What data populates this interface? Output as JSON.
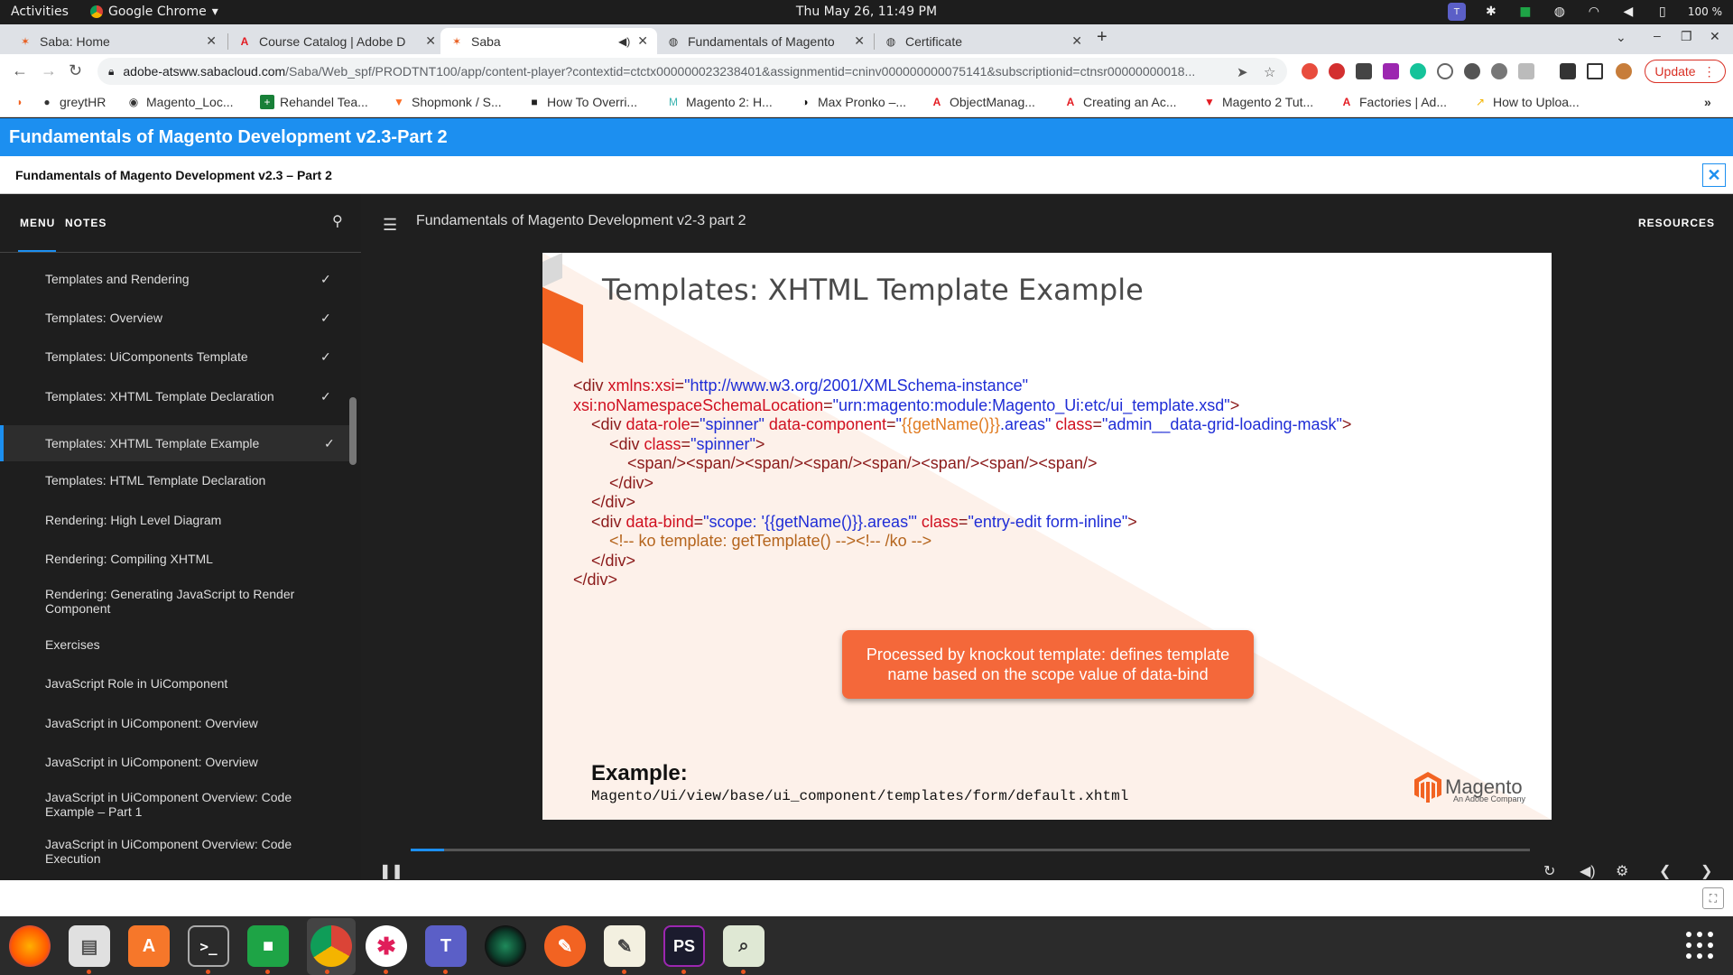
{
  "gnome": {
    "activities": "Activities",
    "app_menu": "Google Chrome",
    "clock": "Thu May 26, 11:49 PM",
    "battery": "100 %"
  },
  "tabs": [
    {
      "title": "Saba: Home",
      "active": false
    },
    {
      "title": "Course Catalog | Adobe D",
      "active": false
    },
    {
      "title": "Saba",
      "active": true
    },
    {
      "title": "Fundamentals of Magento",
      "active": false
    },
    {
      "title": "Certificate",
      "active": false
    }
  ],
  "address": {
    "host": "adobe-atsww.sabacloud.com",
    "path": "/Saba/Web_spf/PRODTNT100/app/content-player?contextid=ctctx000000023238401&assignmentid=cninv000000000075141&subscriptionid=ctnsr00000000018..."
  },
  "update_label": "Update",
  "bookmarks": [
    {
      "label": "greytHR"
    },
    {
      "label": "Magento_Loc..."
    },
    {
      "label": "Rehandel Tea..."
    },
    {
      "label": "Shopmonk / S..."
    },
    {
      "label": "How To Overri..."
    },
    {
      "label": "Magento 2: H..."
    },
    {
      "label": "Max Pronko –..."
    },
    {
      "label": "ObjectManag..."
    },
    {
      "label": "Creating an Ac..."
    },
    {
      "label": "Magento 2 Tut..."
    },
    {
      "label": "Factories | Ad..."
    },
    {
      "label": "How to Uploa..."
    }
  ],
  "app": {
    "header": "Fundamentals of Magento Development v2.3-Part 2",
    "subheader": "Fundamentals of Magento Development v2.3 – Part 2"
  },
  "sidebar": {
    "tab_menu": "MENU",
    "tab_notes": "NOTES",
    "items": [
      {
        "label": "Templates and Rendering",
        "done": true
      },
      {
        "label": "Templates: Overview",
        "done": true
      },
      {
        "label": "Templates: UiComponents Template",
        "done": true
      },
      {
        "label": "Templates: XHTML Template Declaration",
        "done": true
      },
      {
        "label": "Templates: XHTML Template Example",
        "done": true,
        "active": true
      },
      {
        "label": "Templates: HTML Template Declaration",
        "done": false
      },
      {
        "label": "Rendering: High Level Diagram",
        "done": false
      },
      {
        "label": "Rendering: Compiling XHTML",
        "done": false
      },
      {
        "label": "Rendering: Generating JavaScript to Render Component",
        "done": false
      },
      {
        "label": "Exercises",
        "done": false
      },
      {
        "label": "JavaScript Role in UiComponent",
        "done": false
      },
      {
        "label": "JavaScript in UiComponent: Overview",
        "done": false
      },
      {
        "label": "JavaScript in UiComponent: Overview",
        "done": false
      },
      {
        "label": "JavaScript in UiComponent Overview: Code Example – Part 1",
        "done": false
      },
      {
        "label": "JavaScript in UiComponent Overview: Code Execution",
        "done": false
      }
    ]
  },
  "player": {
    "title": "Fundamentals of Magento Development v2-3 part 2",
    "resources": "RESOURCES",
    "progress_fraction": 0.03
  },
  "slide": {
    "title": "Templates: XHTML Template Example",
    "code": {
      "l1a": "<div ",
      "l1b": "xmlns:xsi",
      "l1c": "=",
      "l1d": "\"http://www.w3.org/2001/XMLSchema-instance\"",
      "l2a": "xsi:noNamespaceSchemaLocation",
      "l2b": "=",
      "l2c": "\"urn:magento:module:Magento_Ui:etc/ui_template.xsd\"",
      "l2d": ">",
      "l3a": "    <div ",
      "l3b": "data-role",
      "l3c": "=",
      "l3d": "\"spinner\"",
      "l3e": " data-component",
      "l3f": "=",
      "l3g": "\"",
      "l3h": "{{getName()}}",
      "l3i": ".areas\"",
      "l3j": " class",
      "l3k": "=",
      "l3l": "\"admin__data-grid-loading-mask\"",
      "l3m": ">",
      "l4a": "        <div ",
      "l4b": "class",
      "l4c": "=",
      "l4d": "\"spinner\"",
      "l4e": ">",
      "l5": "            <span/><span/><span/><span/><span/><span/><span/><span/>",
      "l6": "        </div>",
      "l7": "    </div>",
      "l8a": "    <div ",
      "l8b": "data-bind",
      "l8c": "=",
      "l8d": "\"scope: '{{getName()}}.areas'\"",
      "l8e": " class",
      "l8f": "=",
      "l8g": "\"entry-edit form-inline\"",
      "l8h": ">",
      "l9": "        <!-- ko template: getTemplate() --><!-- /ko -->",
      "l10": "    </div>",
      "l11": "</div>"
    },
    "callout": "Processed by knockout template: defines template name based on the scope value of data-bind",
    "example_label": "Example:",
    "example_path": "Magento/Ui/view/base/ui_component/templates/form/default.xhtml",
    "logo_text": "Magento",
    "logo_sub": "An Adobe Company"
  },
  "colors": {
    "accent": "#1c8ff0",
    "callout": "#f4683a",
    "update": "#d93025"
  }
}
